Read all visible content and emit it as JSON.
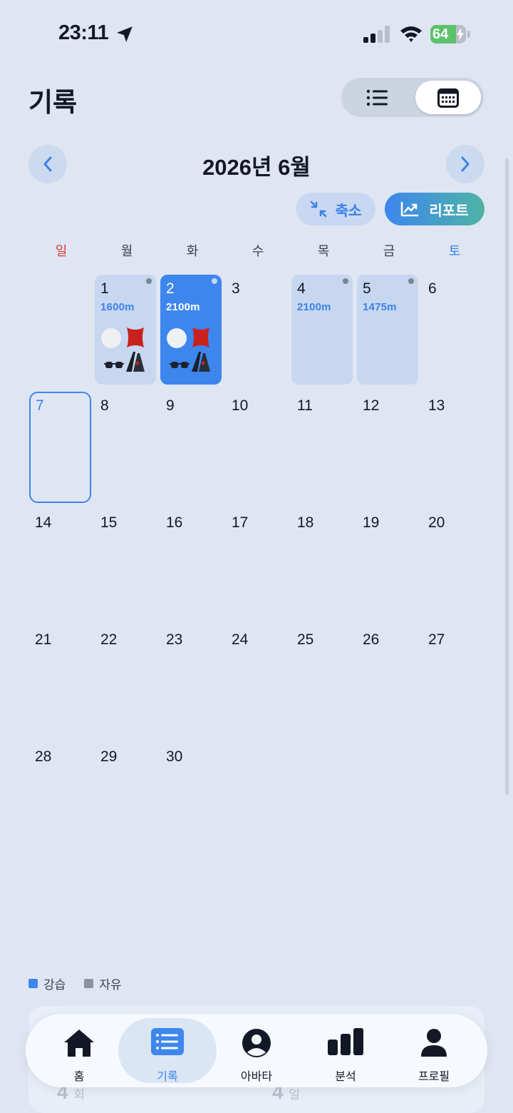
{
  "status": {
    "time": "23:11",
    "battery": "64"
  },
  "header": {
    "title": "기록"
  },
  "calendar": {
    "month_title": "2026년 6월",
    "shrink_label": "축소",
    "report_label": "리포트",
    "weekdays": [
      "일",
      "월",
      "화",
      "수",
      "목",
      "금",
      "토"
    ],
    "records": {
      "d1": {
        "distance": "1600m"
      },
      "d2": {
        "distance": "2100m"
      },
      "d4": {
        "distance": "2100m"
      },
      "d5": {
        "distance": "1475m"
      }
    },
    "today": 7,
    "days_in_month": 30,
    "first_weekday": 1
  },
  "legend": {
    "lesson": "강습",
    "free": "자유"
  },
  "peek": {
    "count_a": "4",
    "unit_a": "회",
    "count_b": "4",
    "unit_b": "일"
  },
  "tabs": [
    {
      "label": "홈"
    },
    {
      "label": "기록"
    },
    {
      "label": "아바타"
    },
    {
      "label": "분석"
    },
    {
      "label": "프로필"
    }
  ],
  "colors": {
    "accent": "#3d86ee",
    "sunday": "#d83a3a",
    "saturday": "#3a82e8",
    "lesson": "#3d86ee",
    "free": "#8a929f"
  }
}
